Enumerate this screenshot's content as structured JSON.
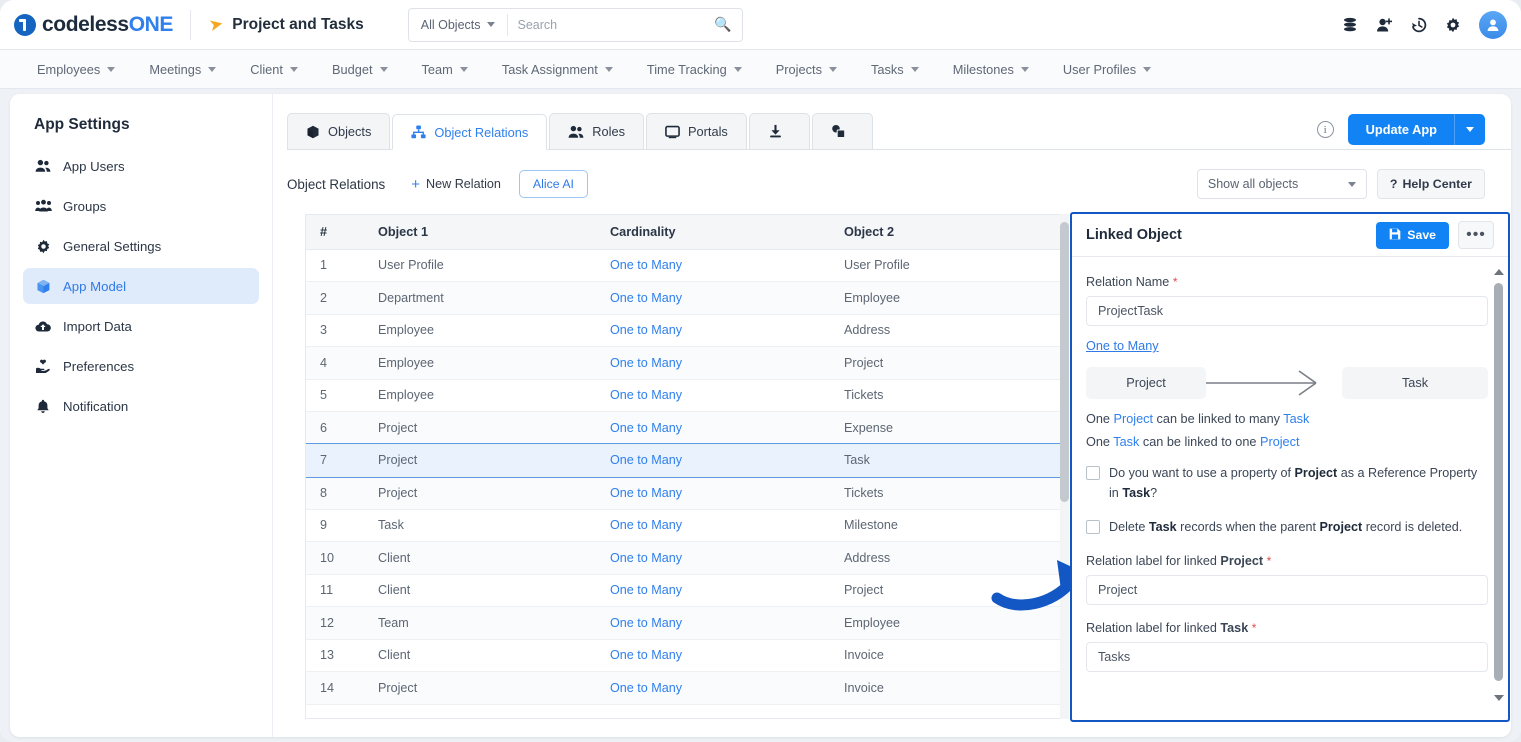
{
  "brand": {
    "text_light": "codeless",
    "text_bold": "ONE"
  },
  "topbar": {
    "app_title": "Project and Tasks",
    "plane_icon": "paper-plane-icon",
    "search": {
      "scope": "All Objects",
      "placeholder": "Search",
      "value": ""
    },
    "icons": [
      "database-icon",
      "add-user-icon",
      "history-icon",
      "gear-icon",
      "avatar-icon"
    ]
  },
  "menubar": {
    "items": [
      {
        "label": "Employees"
      },
      {
        "label": "Meetings"
      },
      {
        "label": "Client"
      },
      {
        "label": "Budget"
      },
      {
        "label": "Team"
      },
      {
        "label": "Task Assignment"
      },
      {
        "label": "Time Tracking"
      },
      {
        "label": "Projects"
      },
      {
        "label": "Tasks"
      },
      {
        "label": "Milestones"
      },
      {
        "label": "User Profiles"
      }
    ]
  },
  "sidebar": {
    "title": "App Settings",
    "items": [
      {
        "label": "App Users",
        "icon": "users-icon",
        "active": false
      },
      {
        "label": "Groups",
        "icon": "group-icon",
        "active": false
      },
      {
        "label": "General Settings",
        "icon": "gear-icon",
        "active": false
      },
      {
        "label": "App Model",
        "icon": "cube-icon",
        "active": true
      },
      {
        "label": "Import Data",
        "icon": "cloud-upload-icon",
        "active": false
      },
      {
        "label": "Preferences",
        "icon": "hand-heart-icon",
        "active": false
      },
      {
        "label": "Notification",
        "icon": "bell-icon",
        "active": false
      }
    ]
  },
  "tabs": [
    {
      "label": "Objects",
      "icon": "cube-icon",
      "active": false
    },
    {
      "label": "Object Relations",
      "icon": "relations-icon",
      "active": true
    },
    {
      "label": "Roles",
      "icon": "users-icon",
      "active": false
    },
    {
      "label": "Portals",
      "icon": "monitor-icon",
      "active": false
    },
    {
      "label": "",
      "icon": "download-icon",
      "active": false
    },
    {
      "label": "",
      "icon": "shapes-icon",
      "active": false
    }
  ],
  "header_actions": {
    "info_icon": "info-icon",
    "update_label": "Update App",
    "update_caret": "chevron-down-icon"
  },
  "toolbar": {
    "title": "Object Relations",
    "new_relation_label": "New Relation",
    "alice_ai_label": "Alice AI",
    "show_all_label": "Show all objects",
    "help_center_label": "Help Center",
    "help_mark": "?"
  },
  "table": {
    "columns": [
      "#",
      "Object 1",
      "Cardinality",
      "Object 2"
    ],
    "rows": [
      {
        "n": "1",
        "o1": "User Profile",
        "card": "One to Many",
        "o2": "User Profile",
        "selected": false
      },
      {
        "n": "2",
        "o1": "Department",
        "card": "One to Many",
        "o2": "Employee",
        "selected": false
      },
      {
        "n": "3",
        "o1": "Employee",
        "card": "One to Many",
        "o2": "Address",
        "selected": false
      },
      {
        "n": "4",
        "o1": "Employee",
        "card": "One to Many",
        "o2": "Project",
        "selected": false
      },
      {
        "n": "5",
        "o1": "Employee",
        "card": "One to Many",
        "o2": "Tickets",
        "selected": false
      },
      {
        "n": "6",
        "o1": "Project",
        "card": "One to Many",
        "o2": "Expense",
        "selected": false
      },
      {
        "n": "7",
        "o1": "Project",
        "card": "One to Many",
        "o2": "Task",
        "selected": true
      },
      {
        "n": "8",
        "o1": "Project",
        "card": "One to Many",
        "o2": "Tickets",
        "selected": false
      },
      {
        "n": "9",
        "o1": "Task",
        "card": "One to Many",
        "o2": "Milestone",
        "selected": false
      },
      {
        "n": "10",
        "o1": "Client",
        "card": "One to Many",
        "o2": "Address",
        "selected": false
      },
      {
        "n": "11",
        "o1": "Client",
        "card": "One to Many",
        "o2": "Project",
        "selected": false
      },
      {
        "n": "12",
        "o1": "Team",
        "card": "One to Many",
        "o2": "Employee",
        "selected": false
      },
      {
        "n": "13",
        "o1": "Client",
        "card": "One to Many",
        "o2": "Invoice",
        "selected": false
      },
      {
        "n": "14",
        "o1": "Project",
        "card": "One to Many",
        "o2": "Invoice",
        "selected": false
      }
    ]
  },
  "panel": {
    "title": "Linked Object",
    "save_label": "Save",
    "save_icon": "save-icon",
    "more_label": "•••",
    "relation_name_label": "Relation Name",
    "relation_name_value": "ProjectTask",
    "cardinality_link": "One to Many",
    "diagram": {
      "left": "Project",
      "right": "Task"
    },
    "sentence1": {
      "pre": "One ",
      "a": "Project",
      "mid": " can be linked to many ",
      "b": "Task"
    },
    "sentence2": {
      "pre": "One ",
      "a": "Task",
      "mid": " can be linked to one ",
      "b": "Project"
    },
    "checkbox1": {
      "p1": "Do you want to use a property of ",
      "b1": "Project",
      "p2": " as a Reference Property in ",
      "b2": "Task",
      "p3": "?",
      "checked": false
    },
    "checkbox2": {
      "p1": "Delete ",
      "b1": "Task",
      "p2": " records when the parent ",
      "b2": "Project",
      "p3": " record is deleted.",
      "checked": false
    },
    "label_project": {
      "pre": "Relation label for linked ",
      "obj": "Project"
    },
    "value_project": "Project",
    "label_task": {
      "pre": "Relation label for linked ",
      "obj": "Task"
    },
    "value_task": "Tasks"
  },
  "annotation": {
    "arrow": "curved-arrow-right",
    "color": "#1257c4"
  },
  "colors": {
    "accent": "#1283f5",
    "link": "#2f80ed",
    "highlight": "#1257c4",
    "selected_row": "#eaf2fd"
  }
}
